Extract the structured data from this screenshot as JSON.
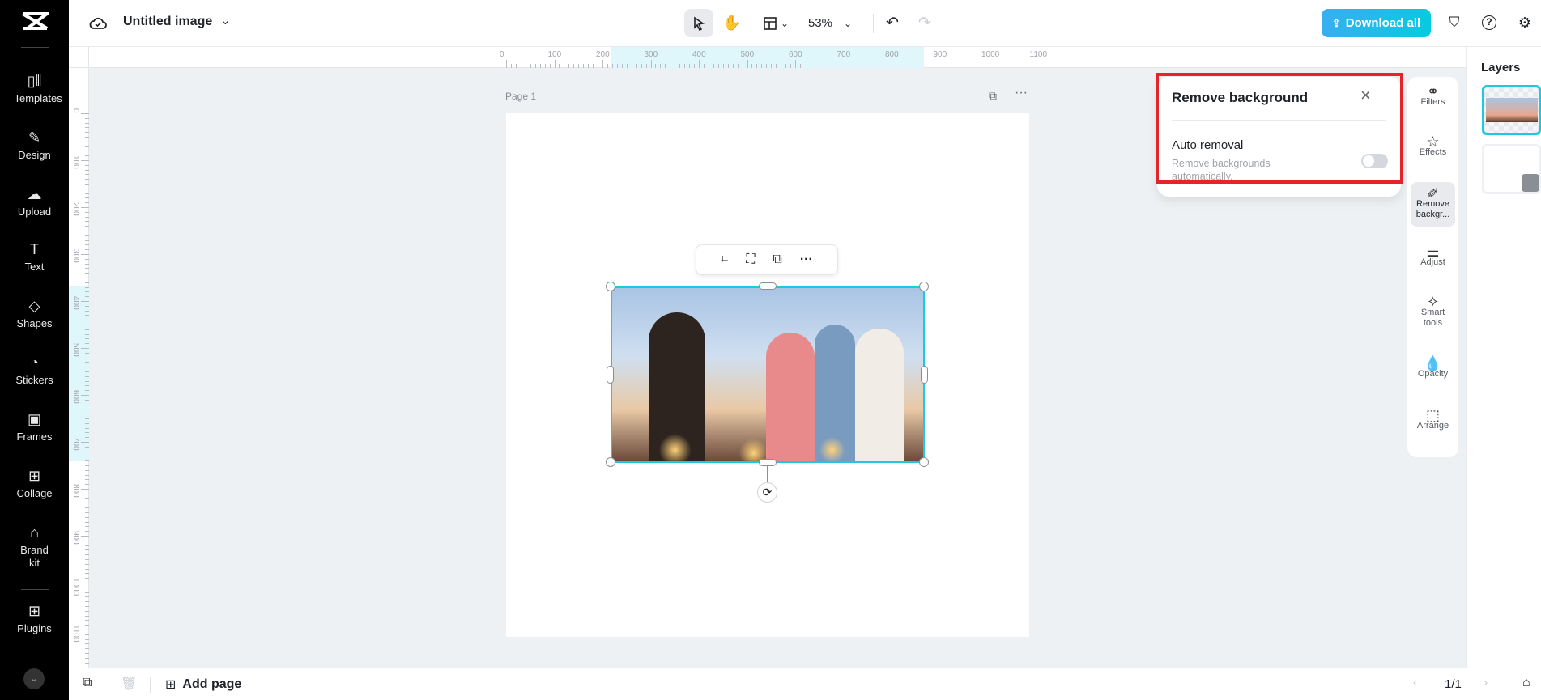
{
  "sidebar": {
    "items": [
      {
        "label": "Templates",
        "icon": "templates-icon"
      },
      {
        "label": "Design",
        "icon": "design-icon"
      },
      {
        "label": "Upload",
        "icon": "upload-icon"
      },
      {
        "label": "Text",
        "icon": "text-icon"
      },
      {
        "label": "Shapes",
        "icon": "shapes-icon"
      },
      {
        "label": "Stickers",
        "icon": "stickers-icon"
      },
      {
        "label": "Frames",
        "icon": "frames-icon"
      },
      {
        "label": "Collage",
        "icon": "collage-icon"
      },
      {
        "label": "Brand kit",
        "icon": "brand-kit-icon"
      },
      {
        "label": "Plugins",
        "icon": "plugins-icon"
      }
    ]
  },
  "header": {
    "title": "Untitled image",
    "zoom": "53%",
    "download_label": "Download all",
    "accent": "#1ec8e0"
  },
  "rulers": {
    "h": [
      "0",
      "100",
      "200",
      "300",
      "400",
      "500",
      "600",
      "700",
      "800",
      "900",
      "1000",
      "1100"
    ],
    "v": [
      "0",
      "100",
      "200",
      "300",
      "400",
      "500",
      "600",
      "700",
      "800",
      "900",
      "1000",
      "1100"
    ]
  },
  "canvas": {
    "page_label": "Page 1"
  },
  "popup": {
    "title": "Remove background",
    "auto_title": "Auto removal",
    "auto_desc": "Remove backgrounds automatically.",
    "auto_enabled": false
  },
  "tools": [
    {
      "label": "Filters"
    },
    {
      "label": "Effects"
    },
    {
      "label": "Remove backgr..."
    },
    {
      "label": "Adjust"
    },
    {
      "label": "Smart tools"
    },
    {
      "label": "Opacity"
    },
    {
      "label": "Arrange"
    }
  ],
  "layers": {
    "title": "Layers"
  },
  "bottom": {
    "add_page": "Add page",
    "page_count": "1/1"
  }
}
